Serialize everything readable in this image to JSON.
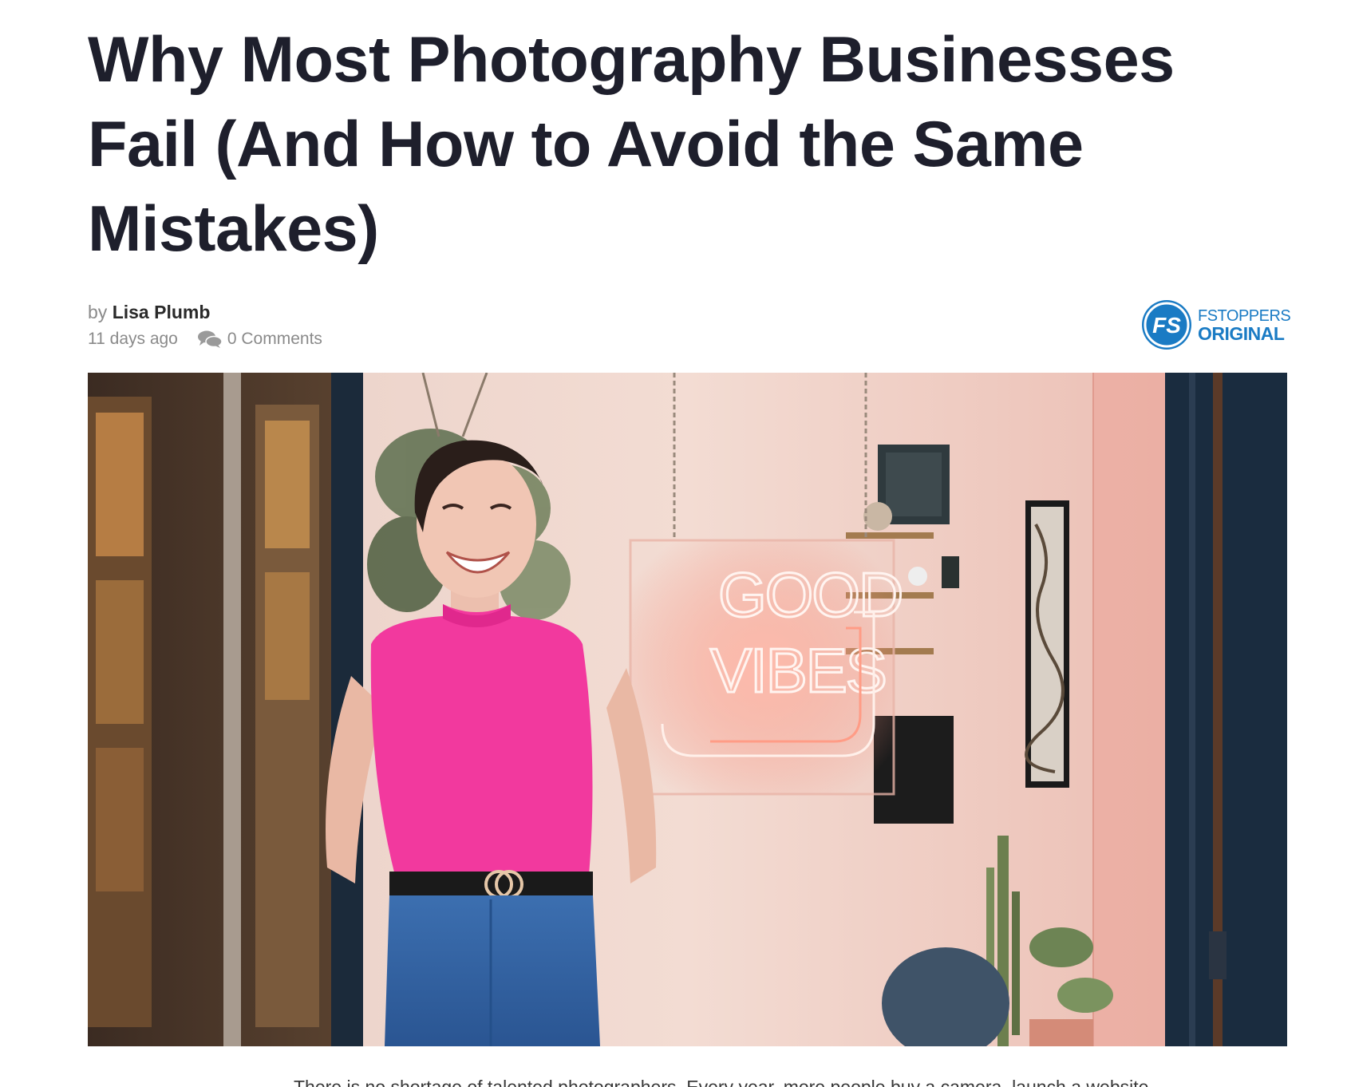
{
  "article": {
    "title": "Why Most Photography Businesses Fail (And How to Avoid the Same Mistakes)",
    "byline_prefix": "by",
    "author": "Lisa Plumb",
    "date": "11 days ago",
    "comments": "0 Comments",
    "badge": {
      "logo_text": "FS",
      "line1": "FSTOPPERS",
      "line2": "ORIGINAL"
    },
    "hero": {
      "sign_line1": "GOOD",
      "sign_line2": "VIBES"
    },
    "first_paragraph": "There is no shortage of talented photographers. Every year, more people buy a camera, launch a website"
  },
  "colors": {
    "title": "#1e1f2c",
    "meta": "#8a8a8a",
    "brand": "#1a7bc4",
    "top_pink": "#f2399e"
  },
  "icons": {
    "comments": "speech-bubbles-icon"
  }
}
